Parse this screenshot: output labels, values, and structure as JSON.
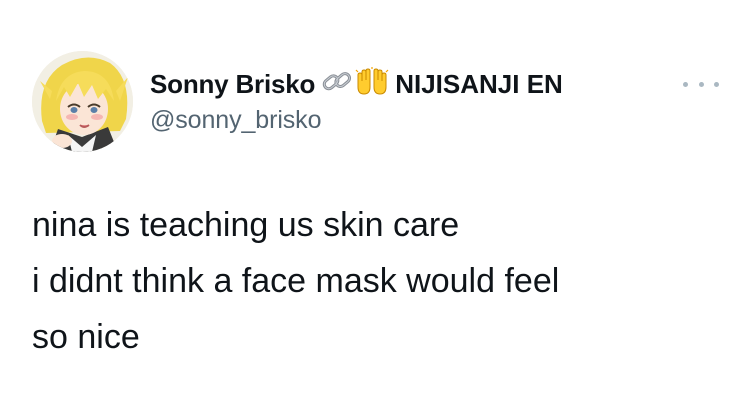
{
  "author": {
    "display_name": "Sonny Brisko",
    "affiliation": "NIJISANJI EN",
    "handle": "@sonny_brisko",
    "avatar_icon": "anime-avatar-blonde",
    "name_emojis": [
      "link-emoji-icon",
      "raising-hands-emoji-icon"
    ]
  },
  "tweet": {
    "lines": [
      "nina is teaching us skin care",
      "i didnt think a face mask would feel",
      "so nice"
    ]
  },
  "colors": {
    "text": "#0f1419",
    "secondary": "#536471",
    "more_dots": "#aab8c2"
  }
}
